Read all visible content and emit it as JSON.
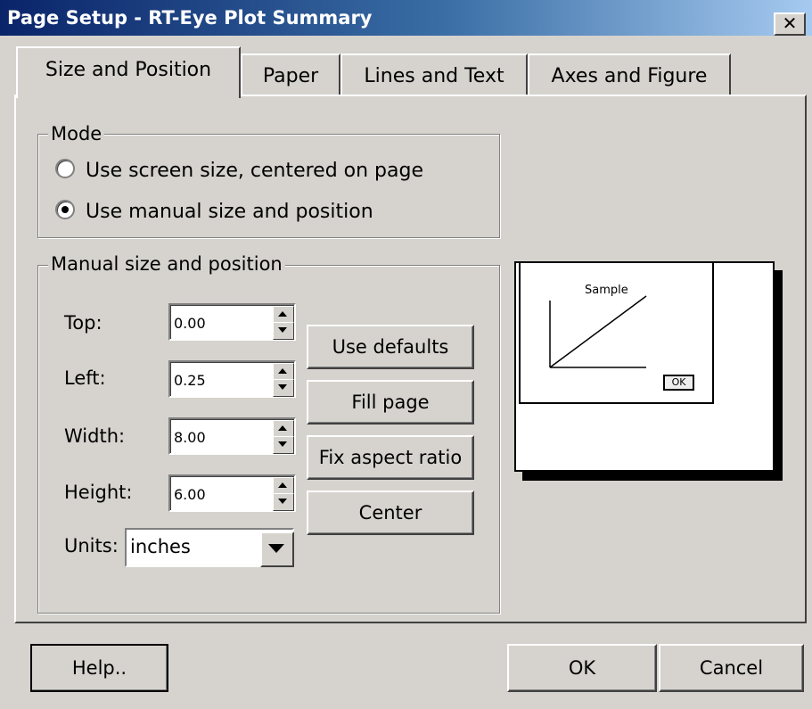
{
  "window": {
    "title": "Page Setup - RT-Eye Plot Summary",
    "close_glyph": "✕"
  },
  "tabs": [
    {
      "label": "Size and Position",
      "active": true
    },
    {
      "label": "Paper",
      "active": false
    },
    {
      "label": "Lines and Text",
      "active": false
    },
    {
      "label": "Axes and Figure",
      "active": false
    }
  ],
  "mode": {
    "legend": "Mode",
    "options": [
      {
        "label": "Use screen size, centered on page",
        "checked": false
      },
      {
        "label": "Use manual size and position",
        "checked": true
      }
    ]
  },
  "manual": {
    "legend": "Manual size and position",
    "fields": [
      {
        "label": "Top:",
        "value": "0.00"
      },
      {
        "label": "Left:",
        "value": "0.25"
      },
      {
        "label": "Width:",
        "value": "8.00"
      },
      {
        "label": "Height:",
        "value": "6.00"
      }
    ],
    "units": {
      "label": "Units:",
      "value": "inches"
    },
    "buttons": {
      "use_defaults": "Use defaults",
      "fill_page": "Fill page",
      "fix_aspect": "Fix aspect ratio",
      "center": "Center"
    }
  },
  "preview": {
    "sample_label": "Sample",
    "ok_label": "OK"
  },
  "footer": {
    "help": "Help..",
    "ok": "OK",
    "cancel": "Cancel"
  }
}
